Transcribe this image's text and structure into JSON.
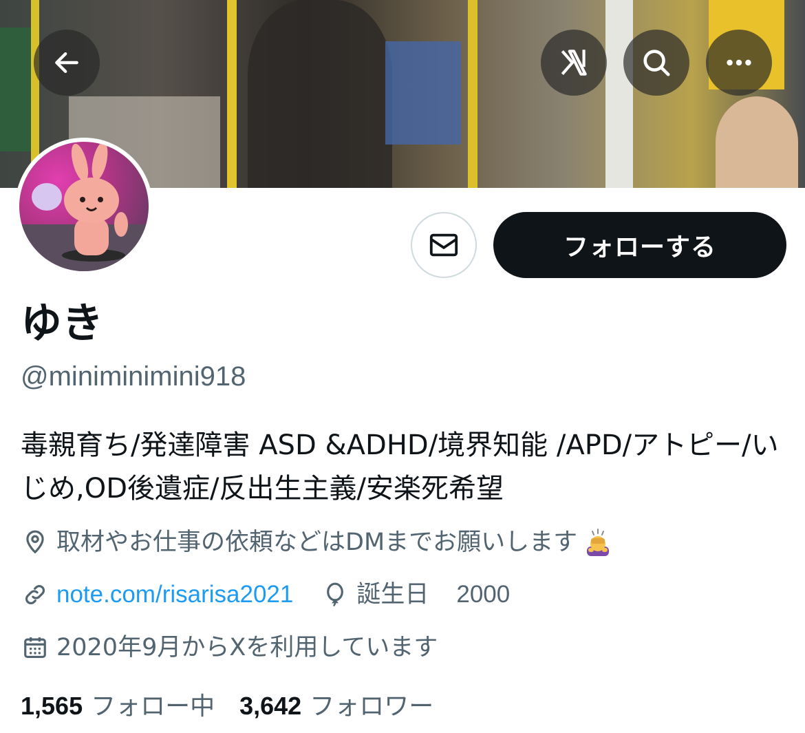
{
  "header": {
    "back_icon": "arrow-left-icon",
    "grok_icon": "grok-icon",
    "search_icon": "search-icon",
    "more_icon": "more-horizontal-icon"
  },
  "profile": {
    "display_name": "ゆき",
    "handle": "@miniminimini918",
    "bio": "毒親育ち/発達障害 ASD &ADHD/境界知能 /APD/アトピー/いじめ,OD後遺症/反出生主義/安楽死希望",
    "location": "取材やお仕事の依頼などはDMまでお願いします",
    "website": "note.com/risarisa2021",
    "birthday_label": "誕生日",
    "birthday_value": "2000",
    "joined": "2020年9月からXを利用しています"
  },
  "actions": {
    "message_icon": "envelope-icon",
    "follow_label": "フォローする"
  },
  "stats": {
    "following_count": "1,565",
    "following_label": "フォロー中",
    "followers_count": "3,642",
    "followers_label": "フォロワー"
  },
  "colors": {
    "accent_link": "#1d9bf0",
    "secondary_text": "#536471",
    "primary_text": "#0f1419",
    "follow_button_bg": "#0f1419"
  }
}
